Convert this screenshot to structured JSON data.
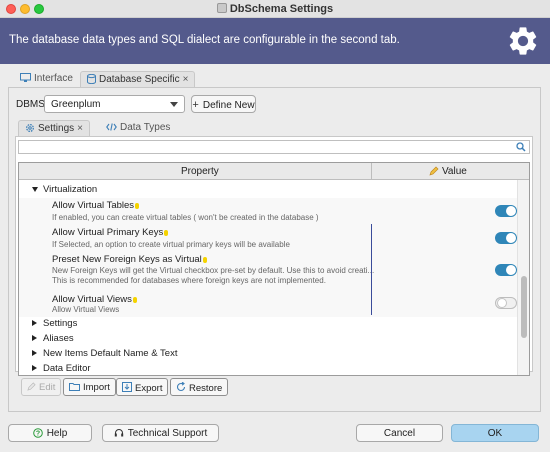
{
  "window": {
    "title": "DbSchema Settings"
  },
  "banner": {
    "text": "The database data types and SQL dialect are configurable in the second tab."
  },
  "main_tabs": [
    {
      "label": "Interface",
      "icon": "monitor-icon"
    },
    {
      "label": "Database Specific",
      "icon": "database-icon",
      "close": "×"
    }
  ],
  "dbms": {
    "label": "DBMS",
    "selected": "Greenplum",
    "define_new": "Define New"
  },
  "sub_tabs": [
    {
      "label": "Settings",
      "icon": "gear-icon",
      "close": "×"
    },
    {
      "label": "Data Types",
      "icon": "code-icon"
    }
  ],
  "search": {
    "value": ""
  },
  "table": {
    "col_property": "Property",
    "col_value": "Value",
    "groups": [
      {
        "label": "Virtualization",
        "expanded": true
      },
      {
        "label": "Settings",
        "expanded": false
      },
      {
        "label": "Aliases",
        "expanded": false
      },
      {
        "label": "New Items Default Name & Text",
        "expanded": false
      },
      {
        "label": "Data Editor",
        "expanded": false
      }
    ],
    "properties": [
      {
        "name": "Allow Virtual Tables",
        "desc1": "If enabled, you can create virtual tables ( won't be created in the database )",
        "desc2": "",
        "value": true
      },
      {
        "name": "Allow Virtual Primary Keys",
        "desc1": "If Selected, an option to create virtual primary keys will be available",
        "desc2": "",
        "value": true
      },
      {
        "name": "Preset New Foreign Keys as Virtual",
        "desc1": "New Foreign Keys will get the Virtual checkbox pre-set by default. Use this to avoid creati...",
        "desc2": "This is recommended for databases where foreign keys are not implemented.",
        "value": true
      },
      {
        "name": "Allow Virtual Views",
        "desc1": "Allow Virtual Views",
        "desc2": "",
        "value": false
      }
    ]
  },
  "actions": {
    "edit": "Edit",
    "import": "Import",
    "export": "Export",
    "restore": "Restore"
  },
  "footer": {
    "help": "Help",
    "support": "Technical Support",
    "cancel": "Cancel",
    "ok": "OK"
  },
  "colors": {
    "banner": "#545a8c",
    "toggle_on": "#2f86b8",
    "ok_button": "#a8d4f0"
  }
}
